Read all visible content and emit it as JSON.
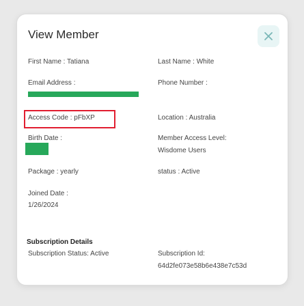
{
  "modal": {
    "title": "View Member",
    "close_symbol": "✕"
  },
  "fields": {
    "first_name": "First Name : Tatiana",
    "last_name": "Last Name : White",
    "email_label": "Email Address :",
    "phone_label": "Phone Number :",
    "access_code": "Access Code : pFbXP",
    "location": "Location : Australia",
    "birth_date_label": "Birth Date :",
    "member_access_label": "Member Access Level:",
    "member_access_value": "Wisdome Users",
    "package": "Package : yearly",
    "status": "status : Active",
    "joined_label": "Joined Date :",
    "joined_value": "1/26/2024"
  },
  "subscription": {
    "heading": "Subscription Details",
    "status": "Subscription Status: Active",
    "id_label": "Subscription Id:",
    "id_value": "64d2fe073e58b6e438e7c53d"
  },
  "colors": {
    "redaction": "#27a85a",
    "highlight": "#e11d2f",
    "close_bg": "#e8f5f5",
    "close_icon": "#7ab7b7"
  }
}
